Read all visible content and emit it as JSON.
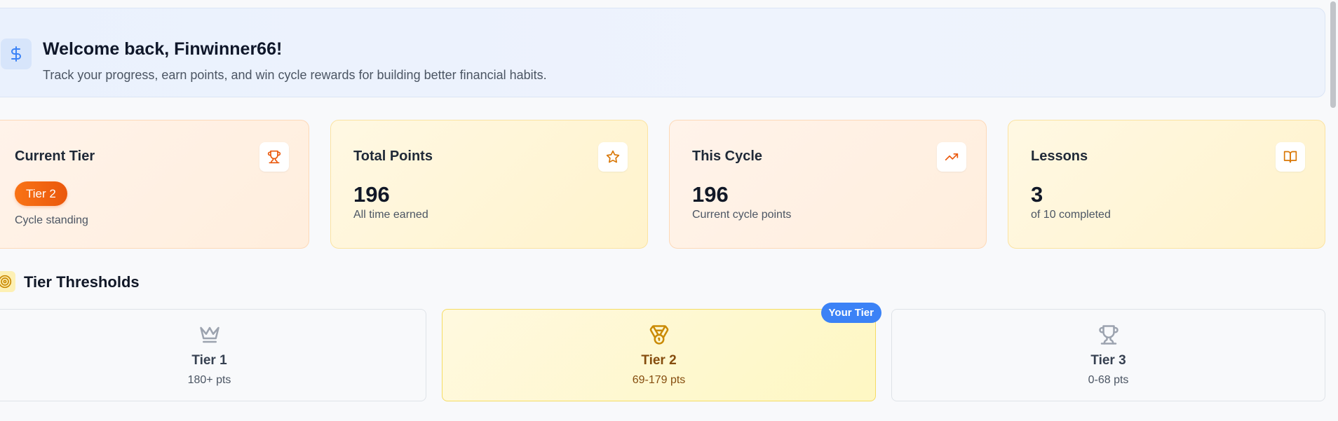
{
  "welcome": {
    "icon": "dollar-icon",
    "title": "Welcome back, Finwinner66!",
    "subtitle": "Track your progress, earn points, and win cycle rewards for building better financial habits."
  },
  "stats": [
    {
      "title": "Current Tier",
      "icon": "trophy-icon",
      "badge": "Tier 2",
      "caption": "Cycle standing"
    },
    {
      "title": "Total Points",
      "icon": "star-icon",
      "value": "196",
      "caption": "All time earned"
    },
    {
      "title": "This Cycle",
      "icon": "trending-up-icon",
      "value": "196",
      "caption": "Current cycle points"
    },
    {
      "title": "Lessons",
      "icon": "book-open-icon",
      "value": "3",
      "caption": "of 10 completed"
    }
  ],
  "thresholds": {
    "title": "Tier Thresholds",
    "icon": "target-icon",
    "your_tier_label": "Your Tier",
    "tiers": [
      {
        "name": "Tier 1",
        "range": "180+ pts",
        "icon": "crown-icon"
      },
      {
        "name": "Tier 2",
        "range": "69-179 pts",
        "icon": "medal-icon",
        "current": true
      },
      {
        "name": "Tier 3",
        "range": "0-68 pts",
        "icon": "trophy-icon"
      }
    ]
  },
  "colors": {
    "accent_blue": "#3b82f6",
    "tier_orange": "#f97316",
    "icon_orange": "#ea580c",
    "icon_amber": "#d97706",
    "icon_gray": "#9ca3af",
    "highlight_yellow": "#fef7c3"
  }
}
